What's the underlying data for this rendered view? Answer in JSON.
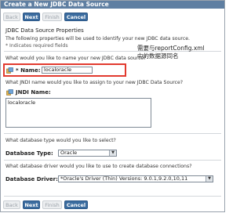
{
  "dialog": {
    "title": "Create a New JDBC Data Source",
    "buttons": {
      "back": "Back",
      "next": "Next",
      "finish": "Finish",
      "cancel": "Cancel"
    },
    "section_title": "JDBC Data Source Properties",
    "section_desc": "The following properties will be used to identify your new JDBC data source.",
    "required_note": "* Indicates required fields",
    "name_question": "What would you like to name your new JDBC data source?",
    "name_label": "* Name:",
    "name_value": "localoracle",
    "jndi_question": "What JNDI name would you like to assign to your new JDBC Data Source?",
    "jndi_label": "JNDI Name:",
    "jndi_value": "localoracle",
    "dbtype_question": "What database type would you like to select?",
    "dbtype_label": "Database Type:",
    "dbtype_value": "Oracle",
    "driver_question": "What database driver would you like to use to create database connections?",
    "driver_label": "Database Driver:",
    "driver_value": "*Oracle's Driver (Thin) Versions: 9.0.1,9.2.0,10,11"
  },
  "annotation": {
    "line1": "需要与reportConfig.xml",
    "line2": "中的数据源同名"
  },
  "colors": {
    "highlight_box": "#e23a2e",
    "titlebar": "#5f7fa2",
    "button": "#3b6c9f"
  }
}
